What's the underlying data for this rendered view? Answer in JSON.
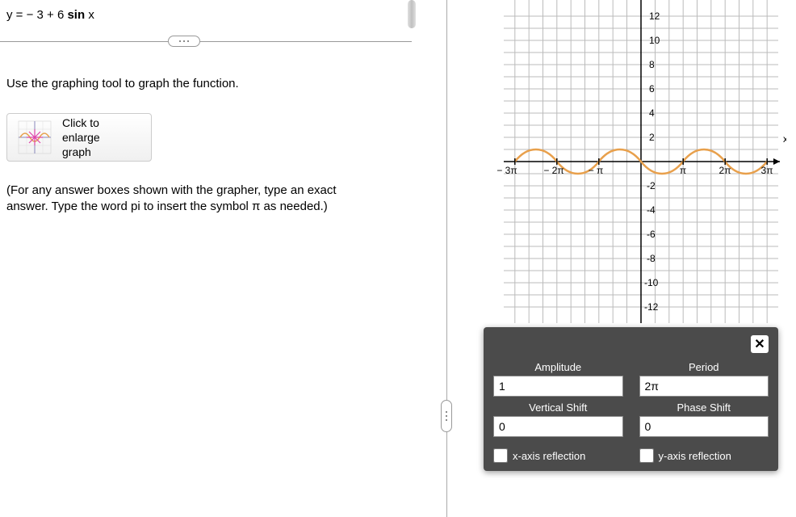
{
  "equation": "y = − 3 + 6 sin x",
  "instruction": "Use the graphing tool to graph the function.",
  "enlarge_button": {
    "line1": "Click to",
    "line2": "enlarge",
    "line3": "graph"
  },
  "note": "(For any answer boxes shown with the grapher, type an exact answer. Type the word pi to insert the symbol π as needed.)",
  "params": {
    "amplitude_label": "Amplitude",
    "amplitude_value": "1",
    "period_label": "Period",
    "period_value": "2π",
    "vshift_label": "Vertical Shift",
    "vshift_value": "0",
    "pshift_label": "Phase Shift",
    "pshift_value": "0",
    "xrefl_label": "x-axis reflection",
    "yrefl_label": "y-axis reflection"
  },
  "chart_data": {
    "type": "line",
    "function": "y = sin(x)",
    "amplitude": 1,
    "period": "2π",
    "vertical_shift": 0,
    "phase_shift": 0,
    "x_axis": {
      "min": "-3π",
      "max": "3π",
      "ticks": [
        "-3π",
        "-2π",
        "-π",
        "π",
        "2π",
        "3π"
      ],
      "label": "x"
    },
    "y_axis": {
      "min": -12,
      "max": 12,
      "ticks": [
        -12,
        -10,
        -8,
        -6,
        -4,
        -2,
        2,
        4,
        6,
        8,
        10,
        12
      ],
      "label": ""
    }
  }
}
